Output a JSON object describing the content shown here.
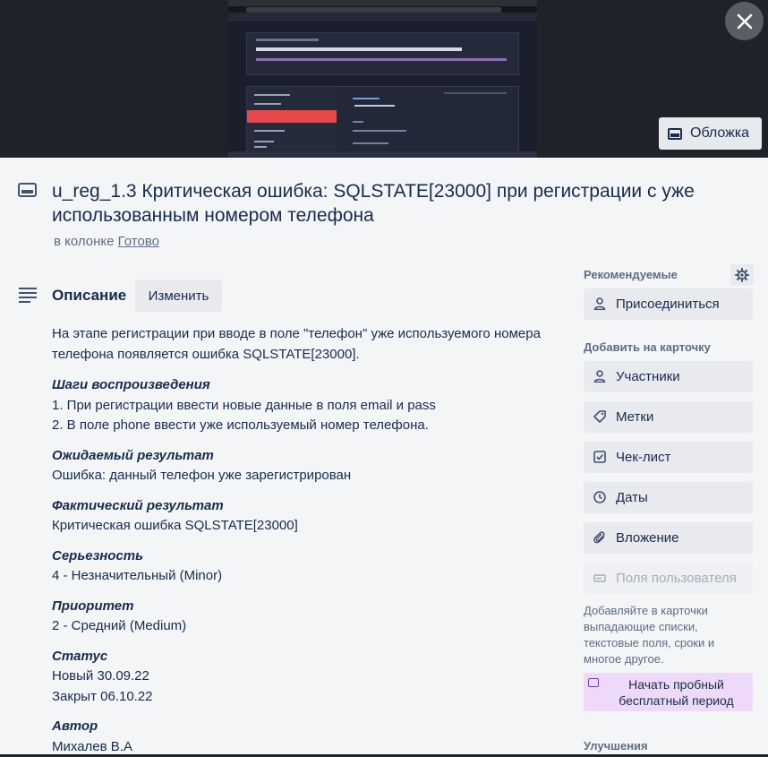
{
  "cover": {
    "button_label": "Обложка"
  },
  "card": {
    "title": "u_reg_1.3 Критическая ошибка: SQLSTATE[23000] при регистрации с уже использованным номером телефона",
    "in_list_prefix": "в колонке",
    "list_name": "Готово"
  },
  "description": {
    "heading": "Описание",
    "edit_label": "Изменить",
    "intro": "На этапе регистрации при вводе в поле \"телефон\" уже используемого номера телефона появляется ошибка SQLSTATE[23000].",
    "steps_heading": "Шаги воспроизведения",
    "steps": [
      "1. При регистрации ввести новые данные в поля email и pass",
      "2. В поле phone ввести уже используемый номер телефона."
    ],
    "expected_heading": "Ожидаемый результат",
    "expected": "Ошибка: данный телефон уже зарегистрирован",
    "actual_heading": "Фактический результат",
    "actual": "Критическая ошибка SQLSTATE[23000]",
    "severity_heading": "Серьезность",
    "severity": "4 - Незначительный (Minor)",
    "priority_heading": "Приоритет",
    "priority": "2 - Средний (Medium)",
    "status_heading": "Статус",
    "status_lines": [
      "Новый 30.09.22",
      "Закрыт 06.10.22"
    ],
    "author_heading": "Автор",
    "author": "Михалев В.А"
  },
  "sidebar": {
    "recommended_label": "Рекомендуемые",
    "join_label": "Присоединиться",
    "add_to_card_label": "Добавить на карточку",
    "buttons": [
      {
        "label": "Участники",
        "icon": "person-icon"
      },
      {
        "label": "Метки",
        "icon": "tag-icon"
      },
      {
        "label": "Чек-лист",
        "icon": "checkbox-icon"
      },
      {
        "label": "Даты",
        "icon": "clock-icon"
      },
      {
        "label": "Вложение",
        "icon": "paperclip-icon"
      },
      {
        "label": "Поля пользователя",
        "icon": "custom-fields-icon"
      }
    ],
    "hint": "Добавляйте в карточки выпадающие списки, текстовые поля, сроки и многое другое.",
    "trial_label": "Начать пробный бесплатный период",
    "improvements_label": "Улучшения"
  }
}
